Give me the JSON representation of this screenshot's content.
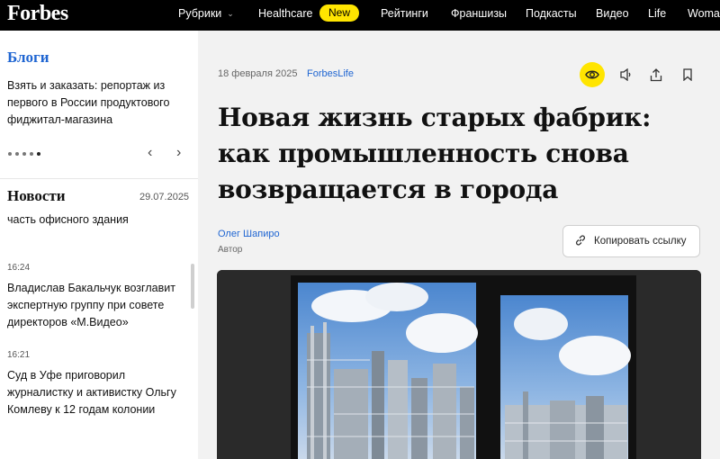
{
  "header": {
    "logo": "Forbes",
    "nav": [
      {
        "label": "Рубрики",
        "has_dropdown": true
      },
      {
        "label": "Healthcare"
      },
      {
        "label": "New",
        "badge": true,
        "color": "#ffe500"
      },
      {
        "label": "Рейтинги"
      },
      {
        "label": "Франшизы"
      },
      {
        "label": "Подкасты"
      },
      {
        "label": "Видео"
      },
      {
        "label": "Life"
      },
      {
        "label": "Woman"
      }
    ]
  },
  "sidebar": {
    "blogs_title": "Блоги",
    "blog_text": "Взять и заказать: репортаж из первого в России продуктового фиджитал-магазина",
    "news_title": "Новости",
    "news_date": "29.07.2025",
    "news_partial": "часть офисного здания",
    "news": [
      {
        "time": "16:24",
        "headline": "Владислав Бакальчук возглавит экспертную группу при совете директоров «М.Видео»"
      },
      {
        "time": "16:21",
        "headline": "Суд в Уфе приговорил журналистку и активистку Ольгу Комлеву к 12 годам колонии"
      }
    ]
  },
  "article": {
    "date": "18 февраля 2025",
    "section": "ForbesLife",
    "headline": "Новая жизнь старых фабрик: как промышленность снова возвращается в города",
    "author": "Олег Шапиро",
    "author_role": "Автор",
    "copy_link": "Копировать ссылку"
  },
  "colors": {
    "accent_yellow": "#ffe500",
    "link_blue": "#2066d2"
  }
}
